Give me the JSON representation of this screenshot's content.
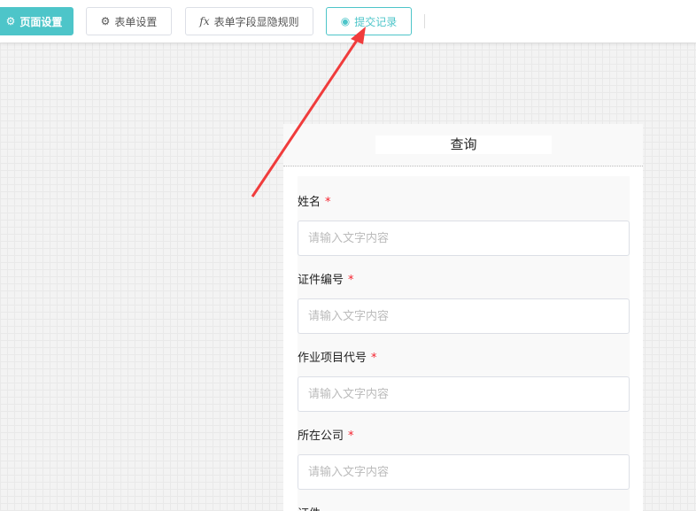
{
  "toolbar": {
    "buttons": [
      {
        "label": "页面设置",
        "icon": "gear-icon"
      },
      {
        "label": "表单设置",
        "icon": "gear-icon"
      },
      {
        "label": "表单字段显隐规则",
        "icon": "fx-icon",
        "icon_text": "fx"
      },
      {
        "label": "提交记录",
        "icon": "eye-icon"
      }
    ]
  },
  "form": {
    "title": "查询",
    "placeholder": "请输入文字内容",
    "required_mark": "*",
    "fields": [
      {
        "label": "姓名"
      },
      {
        "label": "证件编号"
      },
      {
        "label": "作业项目代号"
      },
      {
        "label": "所在公司"
      },
      {
        "label": "证件"
      }
    ]
  },
  "colors": {
    "accent": "#4dc5c9",
    "arrow": "#f03c3c",
    "required": "#f5222d"
  }
}
